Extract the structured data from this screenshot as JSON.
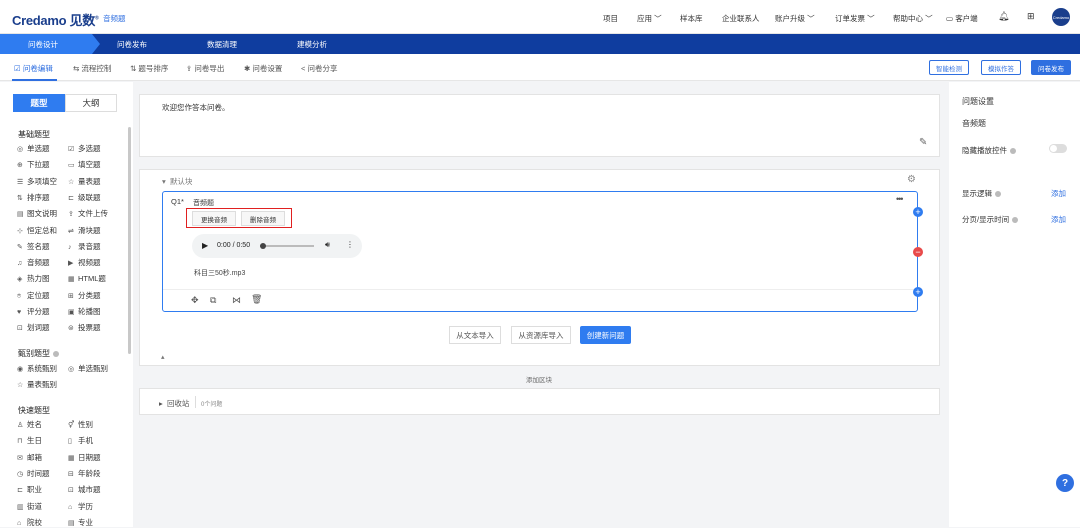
{
  "header": {
    "logo_text": "Credamo",
    "logo_cn": "见数",
    "project_name": "音频题",
    "nav": [
      "项目",
      "应用",
      "样本库",
      "企业联系人",
      "账户升级",
      "订单发票",
      "帮助中心",
      "客户端"
    ],
    "avatar_text": "Credamo"
  },
  "steps": [
    "问卷设计",
    "问卷发布",
    "数据清理",
    "建模分析"
  ],
  "toolbar": {
    "tabs": [
      "问卷编辑",
      "流程控制",
      "题号排序",
      "问卷导出",
      "问卷设置",
      "问卷分享"
    ],
    "buttons": [
      "智能检测",
      "模拟作答",
      "问卷发布"
    ]
  },
  "left": {
    "seg_types": "题型",
    "seg_outline": "大纲",
    "basic_title": "基础题型",
    "basic": [
      {
        "label": "单选题",
        "icon": "◎"
      },
      {
        "label": "多选题",
        "icon": "☑"
      },
      {
        "label": "下拉题",
        "icon": "⊕"
      },
      {
        "label": "填空题",
        "icon": "▭"
      },
      {
        "label": "多项填空",
        "icon": "☰"
      },
      {
        "label": "量表题",
        "icon": "☆"
      },
      {
        "label": "排序题",
        "icon": "⇅"
      },
      {
        "label": "级联题",
        "icon": "⊏"
      },
      {
        "label": "图文说明",
        "icon": "▤"
      },
      {
        "label": "文件上传",
        "icon": "⇪"
      },
      {
        "label": "恒定总和",
        "icon": "⊹"
      },
      {
        "label": "滑块题",
        "icon": "⇌"
      },
      {
        "label": "签名题",
        "icon": "✎"
      },
      {
        "label": "录音题",
        "icon": "♪"
      },
      {
        "label": "音频题",
        "icon": "♫"
      },
      {
        "label": "视频题",
        "icon": "▶"
      },
      {
        "label": "热力图",
        "icon": "◈"
      },
      {
        "label": "HTML题",
        "icon": "▦"
      },
      {
        "label": "定位题",
        "icon": "⌾"
      },
      {
        "label": "分类题",
        "icon": "⊞"
      },
      {
        "label": "评分题",
        "icon": "♥"
      },
      {
        "label": "轮播图",
        "icon": "▣"
      },
      {
        "label": "划词题",
        "icon": "⊡"
      },
      {
        "label": "投票题",
        "icon": "⊜"
      }
    ],
    "screen_title": "甄别题型",
    "screen": [
      {
        "label": "系统甄别",
        "icon": "◉"
      },
      {
        "label": "单选甄别",
        "icon": "◎"
      },
      {
        "label": "量表甄别",
        "icon": "☆"
      }
    ],
    "quick_title": "快速题型",
    "quick": [
      {
        "label": "姓名",
        "icon": "♙"
      },
      {
        "label": "性别",
        "icon": "⚥"
      },
      {
        "label": "生日",
        "icon": "⊓"
      },
      {
        "label": "手机",
        "icon": "▯"
      },
      {
        "label": "邮箱",
        "icon": "✉"
      },
      {
        "label": "日期题",
        "icon": "▦"
      },
      {
        "label": "时间题",
        "icon": "◷"
      },
      {
        "label": "年龄段",
        "icon": "⊟"
      },
      {
        "label": "职业",
        "icon": "⊏"
      },
      {
        "label": "城市题",
        "icon": "⊡"
      },
      {
        "label": "街道",
        "icon": "▥"
      },
      {
        "label": "学历",
        "icon": "⌂"
      },
      {
        "label": "院校",
        "icon": "⌂"
      },
      {
        "label": "专业",
        "icon": "▤"
      }
    ]
  },
  "canvas": {
    "welcome": "欢迎您作答本问卷。",
    "block_name": "默认块",
    "q_num": "Q1*",
    "q_title": "音频题",
    "btn_replace": "更换音频",
    "btn_delete": "删除音频",
    "audio_time": "0:00 / 0:50",
    "audio_file": "科目三50秒.mp3",
    "import_text": "从文本导入",
    "import_lib": "从资源库导入",
    "create_new": "创建新问题",
    "add_block": "添加区块",
    "recycle": "回收站",
    "recycle_count": "0个问题"
  },
  "right": {
    "title": "问题设置",
    "subtitle": "音频题",
    "hide_controls": "隐藏播放控件",
    "display_logic": "显示逻辑",
    "page_time": "分页/显示时间",
    "add1": "添加",
    "add2": "添加"
  },
  "colors": {
    "primary": "#2f7cf0",
    "nav_dark": "#0f3d9f",
    "danger": "#e84a4a",
    "highlight": "#e02020"
  }
}
